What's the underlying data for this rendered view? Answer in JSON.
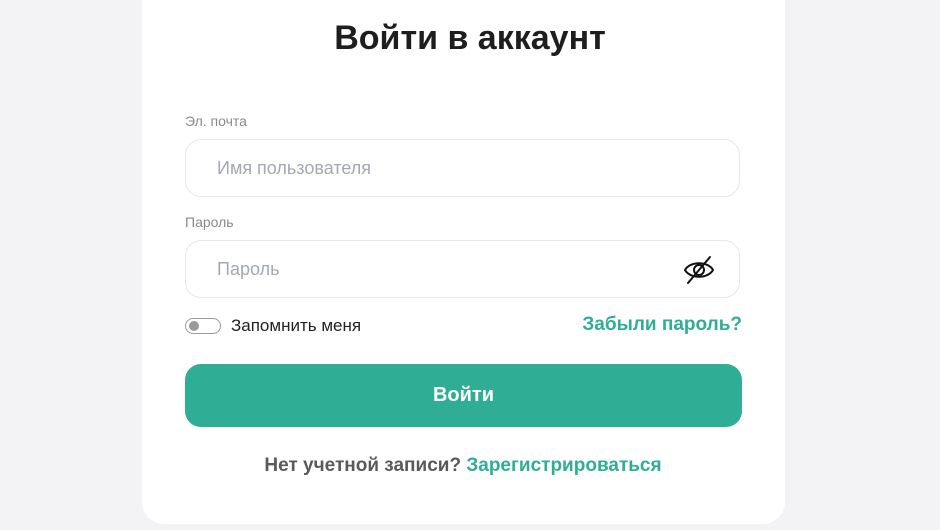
{
  "form": {
    "title": "Войти в аккаунт",
    "email_label": "Эл. почта",
    "email_placeholder": "Имя пользователя",
    "email_value": "",
    "password_label": "Пароль",
    "password_placeholder": "Пароль",
    "password_value": "",
    "password_toggle_icon": "eye-off-icon",
    "remember_label": "Запомнить меня",
    "remember_checked": false,
    "forgot_link": "Забыли пароль?",
    "submit_label": "Войти",
    "no_account_text": "Нет учетной записи?",
    "register_link": "Зарегистрироваться"
  },
  "colors": {
    "accent": "#2fae95",
    "background": "#f3f3f5",
    "card": "#ffffff"
  }
}
